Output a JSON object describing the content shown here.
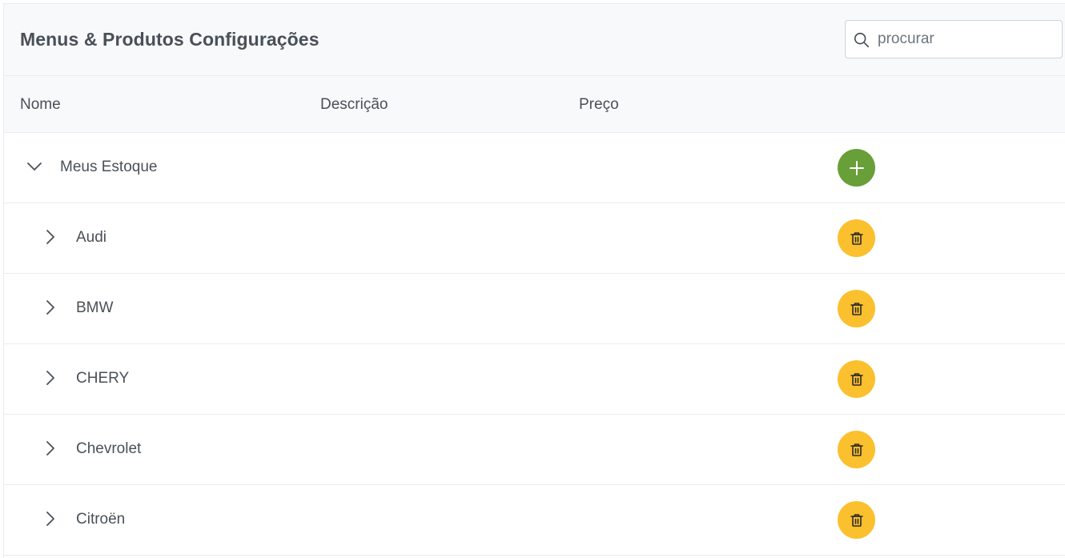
{
  "header": {
    "title": "Menus & Produtos Configurações"
  },
  "search": {
    "placeholder": "procurar",
    "value": "",
    "icon": "search-icon"
  },
  "columns": {
    "name": "Nome",
    "description": "Descrição",
    "price": "Preço"
  },
  "tree": {
    "root": {
      "label": "Meus Estoque",
      "expanded": true,
      "action": "add",
      "action_color": "#689f38"
    },
    "children": [
      {
        "label": "Audi",
        "expanded": false,
        "action": "delete"
      },
      {
        "label": "BMW",
        "expanded": false,
        "action": "delete"
      },
      {
        "label": "CHERY",
        "expanded": false,
        "action": "delete"
      },
      {
        "label": "Chevrolet",
        "expanded": false,
        "action": "delete"
      },
      {
        "label": "Citroën",
        "expanded": false,
        "action": "delete"
      }
    ],
    "delete_color": "#fbc02d"
  }
}
